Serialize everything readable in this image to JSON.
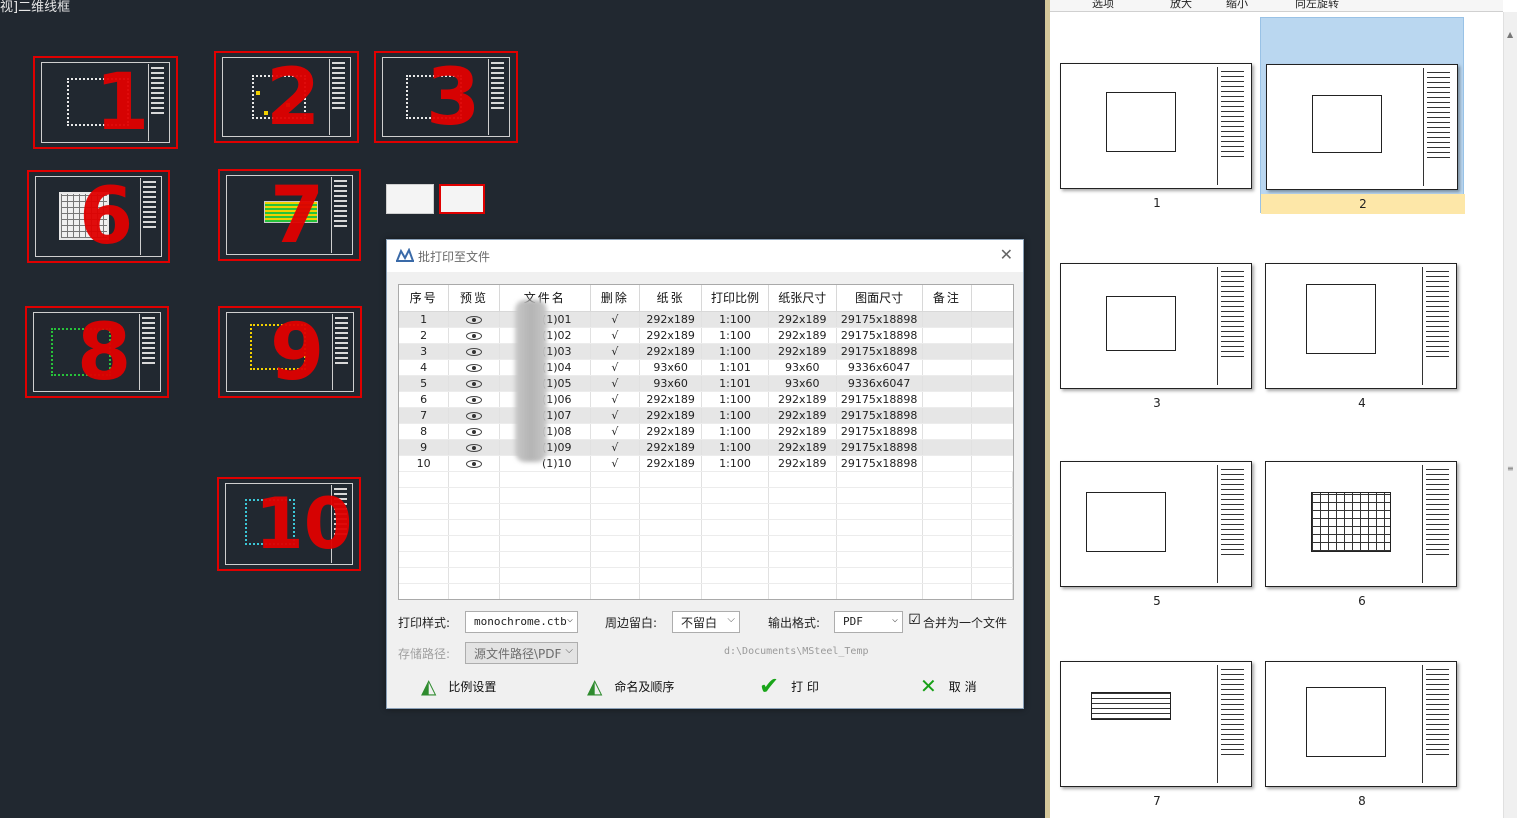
{
  "viewport_label": "视]二维线框",
  "sheets": [
    {
      "label": "1"
    },
    {
      "label": "2"
    },
    {
      "label": "3"
    },
    {
      "label": "6"
    },
    {
      "label": "7"
    },
    {
      "label": "8"
    },
    {
      "label": "9"
    },
    {
      "label": "10"
    }
  ],
  "dialog": {
    "title": "批打印至文件",
    "columns": [
      "序号",
      "预览",
      "文件名",
      "删除",
      "纸张",
      "打印比例",
      "纸张尺寸",
      "图面尺寸",
      "备注"
    ],
    "rows": [
      {
        "no": "1",
        "file": "(1)01",
        "del": "√",
        "paper": "292x189",
        "scale": "1:100",
        "paper_size": "292x189",
        "drawing_size": "29175x18898"
      },
      {
        "no": "2",
        "file": "(1)02",
        "del": "√",
        "paper": "292x189",
        "scale": "1:100",
        "paper_size": "292x189",
        "drawing_size": "29175x18898"
      },
      {
        "no": "3",
        "file": "(1)03",
        "del": "√",
        "paper": "292x189",
        "scale": "1:100",
        "paper_size": "292x189",
        "drawing_size": "29175x18898"
      },
      {
        "no": "4",
        "file": "(1)04",
        "del": "√",
        "paper": "93x60",
        "scale": "1:101",
        "paper_size": "93x60",
        "drawing_size": "9336x6047"
      },
      {
        "no": "5",
        "file": "(1)05",
        "del": "√",
        "paper": "93x60",
        "scale": "1:101",
        "paper_size": "93x60",
        "drawing_size": "9336x6047"
      },
      {
        "no": "6",
        "file": "(1)06",
        "del": "√",
        "paper": "292x189",
        "scale": "1:100",
        "paper_size": "292x189",
        "drawing_size": "29175x18898"
      },
      {
        "no": "7",
        "file": "(1)07",
        "del": "√",
        "paper": "292x189",
        "scale": "1:100",
        "paper_size": "292x189",
        "drawing_size": "29175x18898"
      },
      {
        "no": "8",
        "file": "(1)08",
        "del": "√",
        "paper": "292x189",
        "scale": "1:100",
        "paper_size": "292x189",
        "drawing_size": "29175x18898"
      },
      {
        "no": "9",
        "file": "(1)09",
        "del": "√",
        "paper": "292x189",
        "scale": "1:100",
        "paper_size": "292x189",
        "drawing_size": "29175x18898"
      },
      {
        "no": "10",
        "file": "(1)10",
        "del": "√",
        "paper": "292x189",
        "scale": "1:100",
        "paper_size": "292x189",
        "drawing_size": "29175x18898"
      }
    ],
    "print_style_label": "打印样式:",
    "print_style_value": "monochrome.ctb",
    "margin_label": "周边留白:",
    "margin_value": "不留白",
    "output_format_label": "输出格式:",
    "output_format_value": "PDF",
    "merge_label": "合并为一个文件",
    "merge_checked": "☑",
    "save_path_label": "存储路径:",
    "save_path_value": "源文件路径\\PDF",
    "save_path_text": "d:\\Documents\\MSteel_Temp",
    "btn_scale": "比例设置",
    "btn_naming": "命名及顺序",
    "btn_print": "打 印",
    "btn_cancel": "取 消"
  },
  "preview": {
    "toolbar": [
      "选项",
      "放大",
      "缩小",
      "向左旋转"
    ],
    "pages": [
      "1",
      "2",
      "3",
      "4",
      "5",
      "6",
      "7",
      "8"
    ],
    "selected_page": "2"
  }
}
